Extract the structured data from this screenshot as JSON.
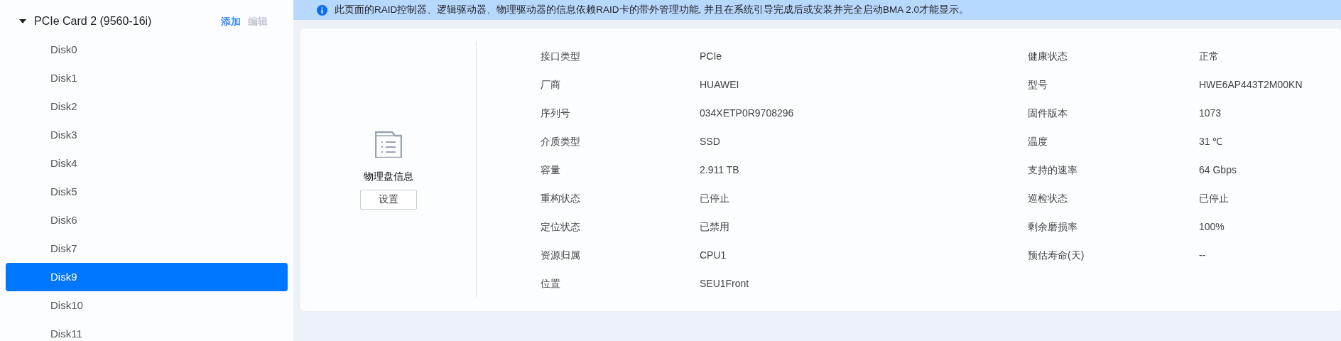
{
  "sidebar": {
    "card": {
      "title": "PCIe Card 2 (9560-16i)",
      "expanded": true,
      "actions": [
        {
          "label": "添加",
          "disabled": false
        },
        {
          "label": "编辑",
          "disabled": true
        }
      ]
    },
    "items": [
      {
        "label": "Disk0",
        "selected": false
      },
      {
        "label": "Disk1",
        "selected": false
      },
      {
        "label": "Disk2",
        "selected": false
      },
      {
        "label": "Disk3",
        "selected": false
      },
      {
        "label": "Disk4",
        "selected": false
      },
      {
        "label": "Disk5",
        "selected": false
      },
      {
        "label": "Disk6",
        "selected": false
      },
      {
        "label": "Disk7",
        "selected": false
      },
      {
        "label": "Disk9",
        "selected": true
      },
      {
        "label": "Disk10",
        "selected": false
      },
      {
        "label": "Disk11",
        "selected": false
      }
    ]
  },
  "notice": "此页面的RAID控制器、逻辑驱动器、物理驱动器的信息依赖RAID卡的带外管理功能, 并且在系统引导完成后或安装并完全启动BMA 2.0才能显示。",
  "panel": {
    "title": "物理盘信息",
    "button": "设置"
  },
  "details": [
    [
      {
        "label": "接口类型",
        "value": "PCIe"
      },
      {
        "label": "健康状态",
        "value": "正常"
      }
    ],
    [
      {
        "label": "厂商",
        "value": "HUAWEI"
      },
      {
        "label": "型号",
        "value": "HWE6AP443T2M00KN"
      }
    ],
    [
      {
        "label": "序列号",
        "value": "034XETP0R9708296"
      },
      {
        "label": "固件版本",
        "value": "1073"
      }
    ],
    [
      {
        "label": "介质类型",
        "value": "SSD"
      },
      {
        "label": "温度",
        "value": "31 ℃"
      }
    ],
    [
      {
        "label": "容量",
        "value": "2.911 TB"
      },
      {
        "label": "支持的速率",
        "value": "64 Gbps"
      }
    ],
    [
      {
        "label": "重构状态",
        "value": "已停止"
      },
      {
        "label": "巡检状态",
        "value": "已停止"
      }
    ],
    [
      {
        "label": "定位状态",
        "value": "已禁用"
      },
      {
        "label": "剩余磨损率",
        "value": "100%"
      }
    ],
    [
      {
        "label": "资源归属",
        "value": "CPU1"
      },
      {
        "label": "预估寿命(天)",
        "value": "--"
      }
    ],
    [
      {
        "label": "位置",
        "value": "SEU1Front"
      }
    ]
  ]
}
